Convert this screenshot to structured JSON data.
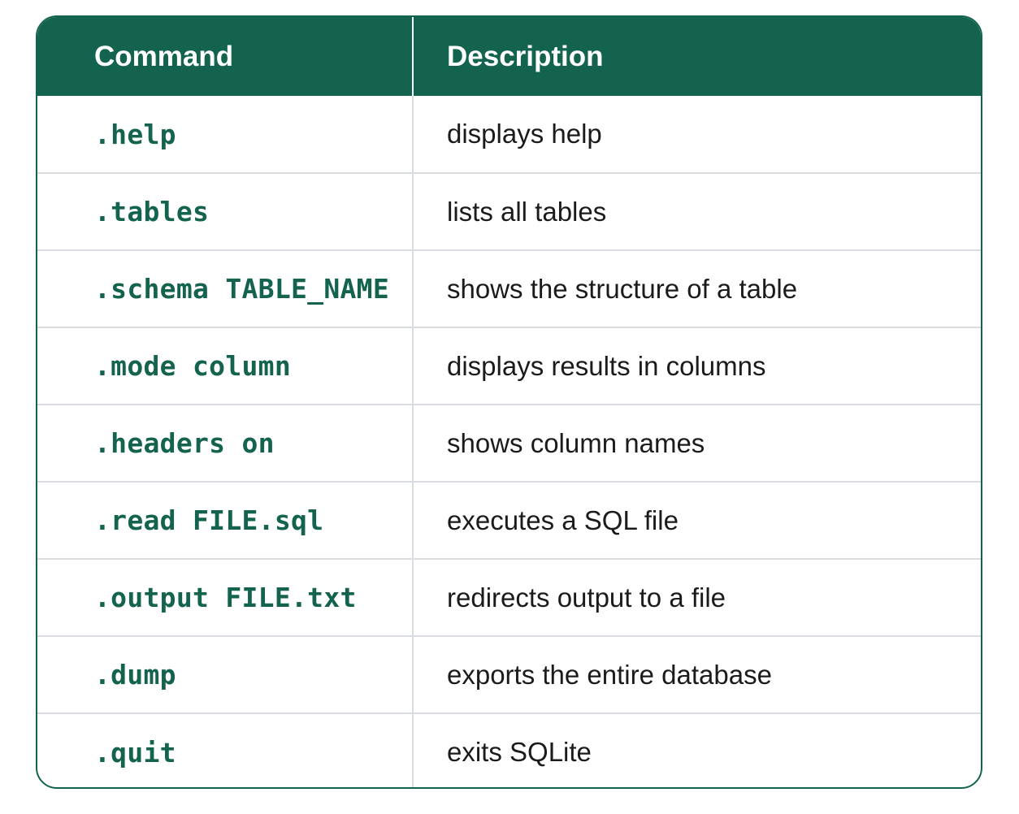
{
  "header": {
    "command": "Command",
    "description": "Description"
  },
  "rows": [
    {
      "command": ".help",
      "description": "displays help"
    },
    {
      "command": ".tables",
      "description": "lists all tables"
    },
    {
      "command": ".schema TABLE_NAME",
      "description": "shows the structure of a table"
    },
    {
      "command": ".mode column",
      "description": "displays results in columns"
    },
    {
      "command": ".headers on",
      "description": "shows column names"
    },
    {
      "command": ".read FILE.sql",
      "description": "executes a SQL file"
    },
    {
      "command": ".output FILE.txt",
      "description": "redirects output to a file"
    },
    {
      "command": ".dump",
      "description": "exports the entire database"
    },
    {
      "command": ".quit",
      "description": "exits SQLite"
    }
  ],
  "colors": {
    "header_bg": "#13634f",
    "command_text": "#13634f",
    "border": "#13634f",
    "divider": "#d9dde2"
  }
}
